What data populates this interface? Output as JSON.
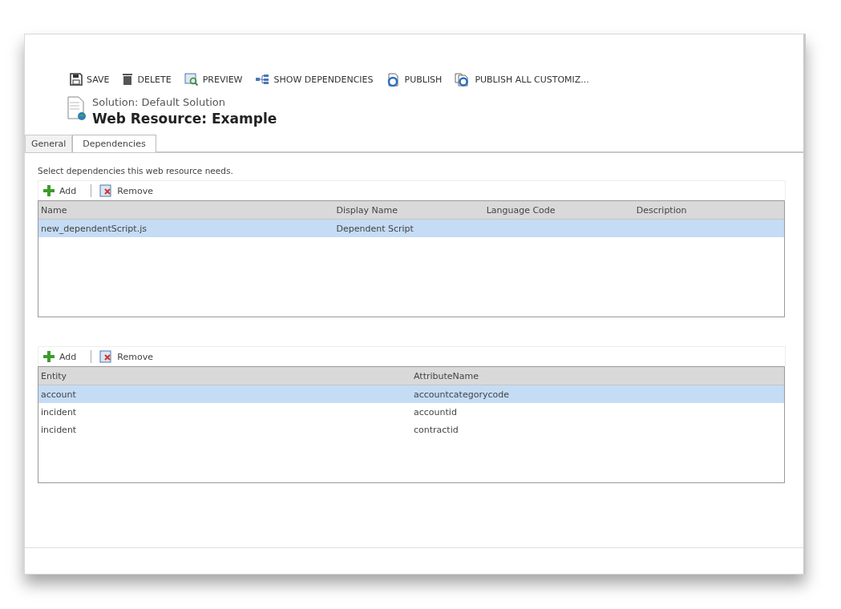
{
  "toolbar": [
    {
      "label": "SAVE",
      "kind": "save"
    },
    {
      "label": "DELETE",
      "kind": "delete"
    },
    {
      "label": "PREVIEW",
      "kind": "preview"
    },
    {
      "label": "SHOW DEPENDENCIES",
      "kind": "dependencies"
    },
    {
      "label": "PUBLISH",
      "kind": "publish"
    },
    {
      "label": "PUBLISH ALL CUSTOMIZ...",
      "kind": "publish-all"
    }
  ],
  "header": {
    "solution": "Solution: Default Solution",
    "title": "Web Resource: Example"
  },
  "tabs": [
    {
      "label": "General",
      "selected": false
    },
    {
      "label": "Dependencies",
      "selected": true
    }
  ],
  "instructions": "Select dependencies this web resource needs.",
  "grids": [
    {
      "actions": [
        {
          "label": "Add",
          "kind": "add"
        },
        {
          "label": "Remove",
          "kind": "remove"
        }
      ],
      "columns": [
        {
          "label": "Name"
        },
        {
          "label": "Display Name"
        },
        {
          "label": "Language Code"
        },
        {
          "label": "Description"
        }
      ],
      "rows": [
        {
          "cells": [
            "new_dependentScript.js",
            "Dependent Script"
          ],
          "selected": true
        }
      ]
    },
    {
      "actions": [
        {
          "label": "Add",
          "kind": "add"
        },
        {
          "label": "Remove",
          "kind": "remove"
        }
      ],
      "columns": [
        {
          "label": "Entity"
        },
        {
          "label": "AttributeName"
        }
      ],
      "rows": [
        {
          "cells": [
            "account",
            "accountcategorycode"
          ],
          "selected": true
        },
        {
          "cells": [
            "incident",
            "accountid"
          ],
          "selected": false
        },
        {
          "cells": [
            "incident",
            "contractid"
          ],
          "selected": false
        }
      ]
    }
  ]
}
